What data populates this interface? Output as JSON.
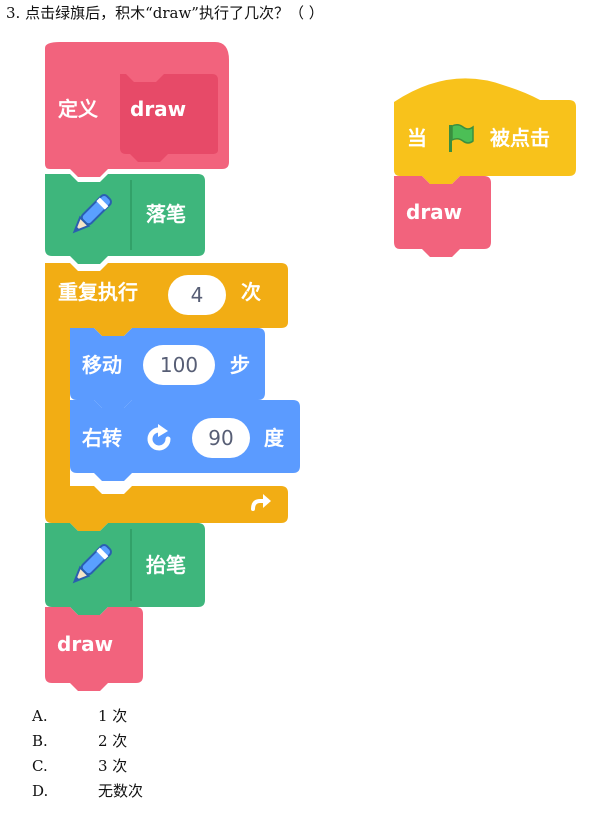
{
  "question": "3. 点击绿旗后，积木“draw”执行了几次？（     ）",
  "blocks": {
    "define_label": "定义",
    "define_name": "draw",
    "pen_down": "落笔",
    "repeat_label": "重复执行",
    "repeat_count": "4",
    "repeat_unit": "次",
    "move_label": "移动",
    "move_value": "100",
    "move_unit": "步",
    "turn_label": "右转",
    "turn_value": "90",
    "turn_unit": "度",
    "pen_up": "抬笔",
    "call_draw": "draw",
    "when_flag_pre": "当",
    "when_flag_post": "被点击",
    "flag_call_draw": "draw"
  },
  "options": [
    {
      "letter": "A.",
      "text": "1 次"
    },
    {
      "letter": "B.",
      "text": "2 次"
    },
    {
      "letter": "C.",
      "text": "3 次"
    },
    {
      "letter": "D.",
      "text": "无数次"
    }
  ],
  "colors": {
    "custom_block": "#f2637d",
    "custom_block_inner": "#e74a68",
    "pen": "#3eb67c",
    "control": "#f2ad14",
    "motion": "#5b9bff",
    "events": "#f8c21b",
    "flag_green": "#4cbf56"
  },
  "icons": [
    "pen-icon",
    "pen-icon",
    "rotate-right-icon",
    "loop-arrow-icon",
    "green-flag-icon"
  ]
}
